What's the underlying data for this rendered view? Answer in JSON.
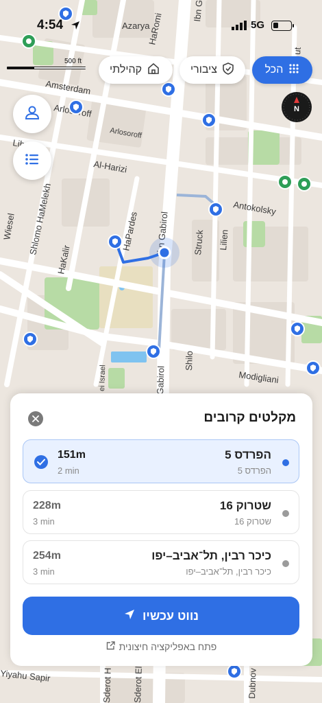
{
  "status_bar": {
    "time": "4:54",
    "network": "5G",
    "battery_level": 0.3
  },
  "map": {
    "scale_label": "500 ft",
    "streets": [
      "Azarya",
      "HaRomi",
      "Ibn G",
      "Amsterdam",
      "Arlosoroff",
      "Arlosoroff",
      "Al-Harizi",
      "Antokolsky",
      "Lib",
      "Shlomo HaMelekh",
      "Wiesel",
      "HaPardes",
      "Ibn Gabirol",
      "Struck",
      "Lilien",
      "HaKalir",
      "Shilo",
      "Modigliani",
      "Arlozorov",
      "ei Israel",
      "Gabirol",
      "Yiyahu Sapir",
      "Sderot H",
      "Sderot Eliya",
      "Dubnov",
      "ut"
    ],
    "compass": "N"
  },
  "filters": {
    "all": {
      "label": "הכל",
      "icon": "grid-icon"
    },
    "public": {
      "label": "ציבורי",
      "icon": "shield-icon"
    },
    "community": {
      "label": "קהילתי",
      "icon": "home-icon"
    }
  },
  "sheet": {
    "title": "מקלטים קרובים",
    "shelters": [
      {
        "name": "הפרדס 5",
        "address": "הפרדס 5",
        "distance": "151m",
        "time": "2 min",
        "selected": true
      },
      {
        "name": "שטרוק 16",
        "address": "שטרוק 16",
        "distance": "228m",
        "time": "3 min",
        "selected": false
      },
      {
        "name": "כיכר רבין, תל־אביב–יפו",
        "address": "כיכר רבין, תל־אביב–יפו",
        "distance": "254m",
        "time": "3 min",
        "selected": false
      }
    ],
    "navigate_label": "נווט עכשיו",
    "external_label": "פתח באפליקציה חיצונית"
  },
  "colors": {
    "accent": "#2f6fe4",
    "community_pin": "#2e9e57",
    "public_pin": "#2f6fe4",
    "map_bg": "#ece6df",
    "park": "#b7dba5"
  }
}
